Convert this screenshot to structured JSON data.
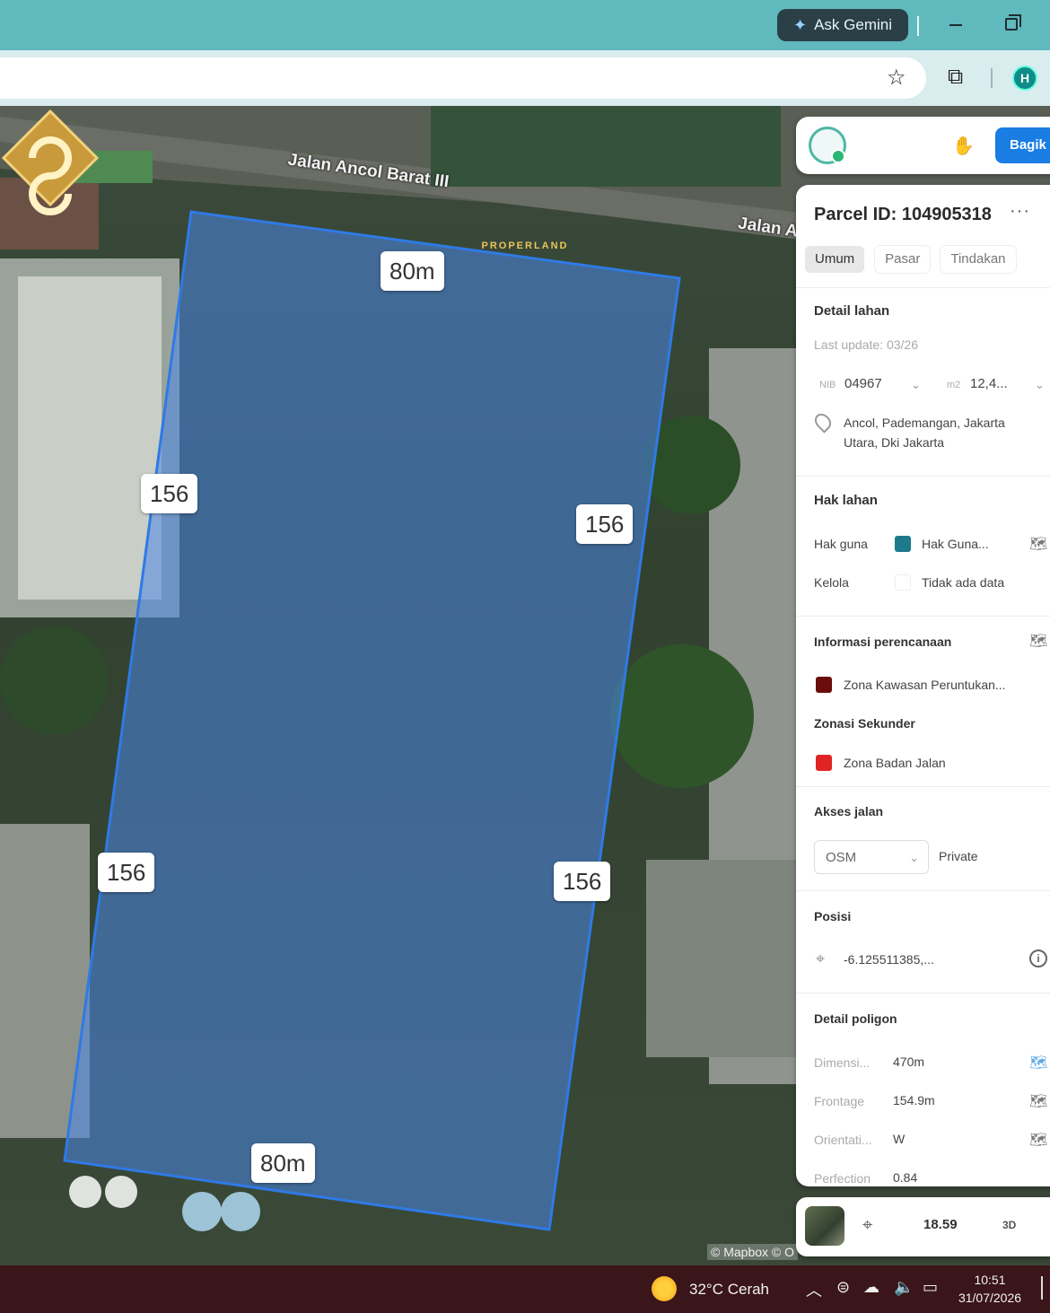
{
  "browser": {
    "gemini_label": "Ask Gemini"
  },
  "map": {
    "street_1": "Jalan Ancol Barat III",
    "street_2": "Jalan A",
    "dimensions": {
      "top": "80m",
      "bottom": "80m",
      "left_upper": "156",
      "left_lower": "156",
      "right_upper": "156",
      "right_lower": "156"
    },
    "watermark": "PROPERLAND",
    "attribution": "© Mapbox © O",
    "polygon_color": "#4a86e8"
  },
  "panel_header": {
    "share_label": "Bagik"
  },
  "panel": {
    "title": "Parcel ID: 104905318",
    "more": "···",
    "tabs": [
      {
        "label": "Umum",
        "active": true
      },
      {
        "label": "Pasar",
        "active": false
      },
      {
        "label": "Tindakan",
        "active": false
      }
    ],
    "detail_lahan": {
      "title": "Detail lahan",
      "last_update": "Last update: 03/26",
      "nib_label": "NIB",
      "nib_value": "04967",
      "area_label": "m2",
      "area_value": "12,4...",
      "address_line1": "Ancol, Pademangan, Jakarta",
      "address_line2": "Utara, Dki Jakarta"
    },
    "hak_lahan": {
      "title": "Hak lahan",
      "hak_guna_label": "Hak guna",
      "hak_guna_value": "Hak Guna...",
      "hak_guna_color": "#1c7a8c",
      "kelola_label": "Kelola",
      "kelola_value": "Tidak ada data"
    },
    "perencanaan": {
      "title": "Informasi perencanaan",
      "zona_value": "Zona Kawasan Peruntukan...",
      "zona_color": "#6b0c0c",
      "sekunder_title": "Zonasi Sekunder",
      "sekunder_value": "Zona Badan Jalan",
      "sekunder_color": "#e02424"
    },
    "akses_jalan": {
      "title": "Akses jalan",
      "select_value": "OSM",
      "access_value": "Private"
    },
    "posisi": {
      "title": "Posisi",
      "coordinate": "-6.125511385,..."
    },
    "detail_poligon": {
      "title": "Detail poligon",
      "rows": [
        {
          "label": "Dimensi...",
          "value": "470m"
        },
        {
          "label": "Frontage",
          "value": "154.9m"
        },
        {
          "label": "Orientati...",
          "value": "W"
        },
        {
          "label": "Perfection",
          "value": "0.84"
        }
      ]
    }
  },
  "bottom_bar": {
    "zoom": "18.59",
    "mode": "3D"
  },
  "taskbar": {
    "weather": "32°C  Cerah",
    "time": "10:51",
    "date": "31/07/2026"
  }
}
